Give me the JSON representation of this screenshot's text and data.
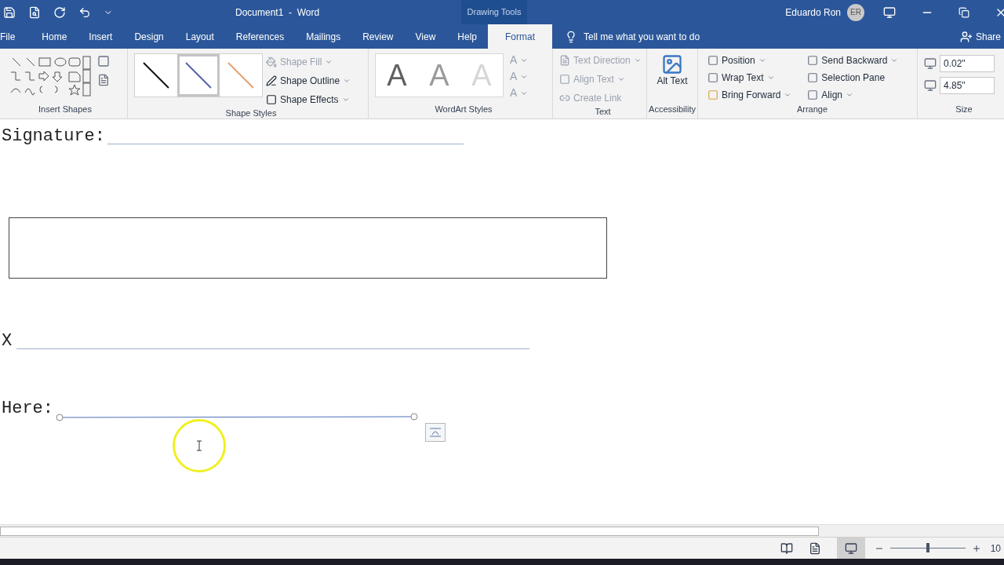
{
  "title_bar": {
    "document_title": "Document1  -  Word",
    "context_label": "Drawing Tools",
    "user_name": "Eduardo Ron",
    "user_initials": "ER"
  },
  "tabs": [
    {
      "label": "File",
      "selected": false
    },
    {
      "label": "Home",
      "selected": false
    },
    {
      "label": "Insert",
      "selected": false
    },
    {
      "label": "Design",
      "selected": false
    },
    {
      "label": "Layout",
      "selected": false
    },
    {
      "label": "References",
      "selected": false
    },
    {
      "label": "Mailings",
      "selected": false
    },
    {
      "label": "Review",
      "selected": false
    },
    {
      "label": "View",
      "selected": false
    },
    {
      "label": "Help",
      "selected": false
    },
    {
      "label": "Format",
      "selected": true
    }
  ],
  "tell_me": "Tell me what you want to do",
  "share": "Share",
  "ribbon": {
    "insert_shapes": {
      "label": "Insert Shapes"
    },
    "shape_styles": {
      "label": "Shape Styles",
      "thumbnails": [
        {
          "color": "#111111",
          "selected": false
        },
        {
          "color": "#5a63b0",
          "selected": true
        },
        {
          "color": "#e0a070",
          "selected": false
        }
      ],
      "buttons": [
        {
          "label": "Shape Fill",
          "disabled": true
        },
        {
          "label": "Shape Outline",
          "disabled": false
        },
        {
          "label": "Shape Effects",
          "disabled": false
        }
      ]
    },
    "wordart_styles": {
      "label": "WordArt Styles",
      "samples": [
        {
          "letter": "A",
          "color": "#606060"
        },
        {
          "letter": "A",
          "color": "#9a9a9a"
        },
        {
          "letter": "A",
          "color": "#d6d6d6"
        }
      ],
      "side": [
        "A",
        "A",
        "A"
      ]
    },
    "text": {
      "label": "Text",
      "buttons": [
        {
          "label": "Text Direction",
          "disabled": true
        },
        {
          "label": "Align Text",
          "disabled": true
        },
        {
          "label": "Create Link",
          "disabled": true
        }
      ]
    },
    "accessibility": {
      "label": "Accessibility",
      "button": "Alt Text"
    },
    "arrange": {
      "label": "Arrange",
      "left": [
        {
          "label": "Position",
          "dropdown": true
        },
        {
          "label": "Wrap Text",
          "dropdown": true
        },
        {
          "label": "Bring Forward",
          "dropdown": true
        }
      ],
      "right": [
        {
          "label": "Send Backward",
          "dropdown": true
        },
        {
          "label": "Selection Pane",
          "dropdown": false
        },
        {
          "label": "Align",
          "dropdown": true
        }
      ]
    },
    "size": {
      "label": "Size",
      "height": "0.02\"",
      "width": "4.85\""
    }
  },
  "document": {
    "signature_label": "Signature:",
    "x_label": "X",
    "here_label": "Here:"
  },
  "status_bar": {
    "zoom": "10",
    "zoom_slider": {
      "level": 0.5
    }
  }
}
